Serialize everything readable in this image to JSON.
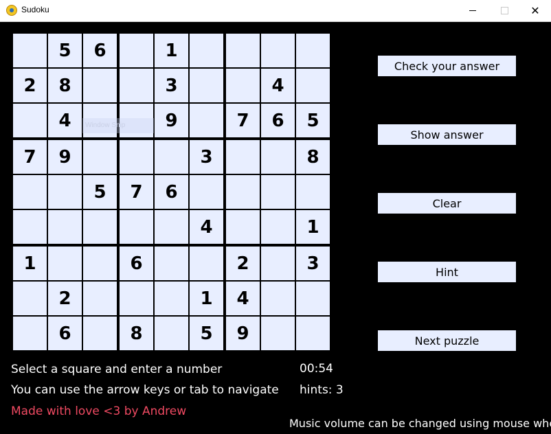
{
  "window": {
    "title": "Sudoku",
    "minimize_label": "—",
    "maximize_label": "☐",
    "close_label": "✕",
    "icon": "pygame-snake-icon"
  },
  "board": [
    [
      "",
      "5",
      "6",
      "",
      "1",
      "",
      "",
      "",
      ""
    ],
    [
      "2",
      "8",
      "",
      "",
      "3",
      "",
      "",
      "4",
      ""
    ],
    [
      "",
      "4",
      "",
      "",
      "9",
      "",
      "7",
      "6",
      "5"
    ],
    [
      "7",
      "9",
      "",
      "",
      "",
      "3",
      "",
      "",
      "8"
    ],
    [
      "",
      "",
      "5",
      "7",
      "6",
      "",
      "",
      "",
      ""
    ],
    [
      "",
      "",
      "",
      "",
      "",
      "4",
      "",
      "",
      "1"
    ],
    [
      "1",
      "",
      "",
      "6",
      "",
      "",
      "2",
      "",
      "3"
    ],
    [
      "",
      "2",
      "",
      "",
      "",
      "1",
      "4",
      "",
      ""
    ],
    [
      "",
      "6",
      "",
      "8",
      "",
      "5",
      "9",
      "",
      ""
    ]
  ],
  "tooltip_ghost": "Window Snip",
  "buttons": {
    "check": "Check your answer",
    "show": "Show answer",
    "clear": "Clear",
    "hint": "Hint",
    "next": "Next puzzle"
  },
  "status": {
    "instruction": "Select a square and enter a number",
    "navigation": "You can use the arrow keys or tab to navigate",
    "credit": "Made with love <3 by Andrew",
    "timer": "00:54",
    "hints": "hints: 3",
    "music": "Music volume can be changed using mouse wheel"
  },
  "colors": {
    "background": "#000000",
    "cell": "#e8eeff",
    "button": "#e8eeff",
    "credit": "#f04a62"
  }
}
